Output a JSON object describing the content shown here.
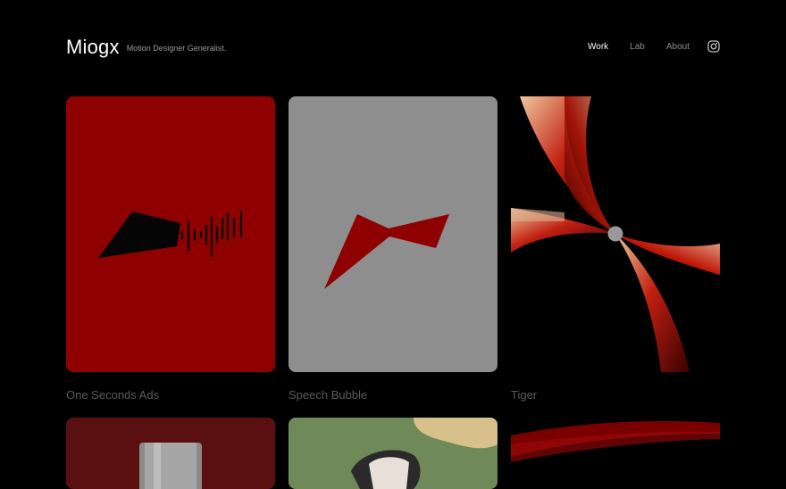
{
  "header": {
    "logo": "Miogx",
    "tagline": "Motion Designer Generalist.",
    "nav": [
      {
        "label": "Work",
        "active": true
      },
      {
        "label": "Lab",
        "active": false
      },
      {
        "label": "About",
        "active": false
      }
    ],
    "social_icon": "instagram-icon"
  },
  "projects": [
    {
      "title": "One Seconds Ads",
      "bg": "#8f0000"
    },
    {
      "title": "Speech Bubble",
      "bg": "#8e8e8e"
    },
    {
      "title": "Tiger",
      "bg": "#000000"
    },
    {
      "title": "",
      "bg": "#5a1010"
    },
    {
      "title": "",
      "bg": "#6f8a58"
    },
    {
      "title": "",
      "bg": "#000000"
    }
  ],
  "colors": {
    "background": "#000000",
    "nav_active": "#ffffff",
    "nav_inactive": "#8c8c8c",
    "caption": "#5a5a5a"
  }
}
